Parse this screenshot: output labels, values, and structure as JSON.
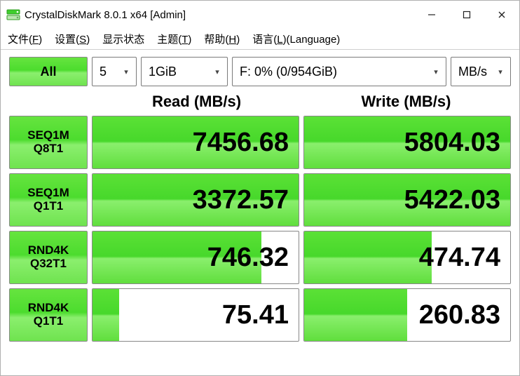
{
  "window": {
    "title": "CrystalDiskMark 8.0.1 x64 [Admin]"
  },
  "menu": {
    "file": {
      "label": "文件(",
      "hot": "F",
      "tail": ")"
    },
    "settings": {
      "label": "设置(",
      "hot": "S",
      "tail": ")"
    },
    "viewstate": {
      "label": "显示状态"
    },
    "theme": {
      "label": "主题(",
      "hot": "T",
      "tail": ")"
    },
    "help": {
      "label": "帮助(",
      "hot": "H",
      "tail": ")"
    },
    "language": {
      "label": "语言(",
      "hot": "L",
      "tail": ")(Language)"
    }
  },
  "controls": {
    "all_label": "All",
    "count": "5",
    "size": "1GiB",
    "drive": "F: 0% (0/954GiB)",
    "unit": "MB/s"
  },
  "headers": {
    "read": "Read (MB/s)",
    "write": "Write (MB/s)"
  },
  "tests": [
    {
      "line1": "SEQ1M",
      "line2": "Q8T1",
      "read": "7456.68",
      "write": "5804.03",
      "read_pct": 100,
      "write_pct": 100
    },
    {
      "line1": "SEQ1M",
      "line2": "Q1T1",
      "read": "3372.57",
      "write": "5422.03",
      "read_pct": 100,
      "write_pct": 100
    },
    {
      "line1": "RND4K",
      "line2": "Q32T1",
      "read": "746.32",
      "write": "474.74",
      "read_pct": 82,
      "write_pct": 62
    },
    {
      "line1": "RND4K",
      "line2": "Q1T1",
      "read": "75.41",
      "write": "260.83",
      "read_pct": 13,
      "write_pct": 50
    }
  ]
}
